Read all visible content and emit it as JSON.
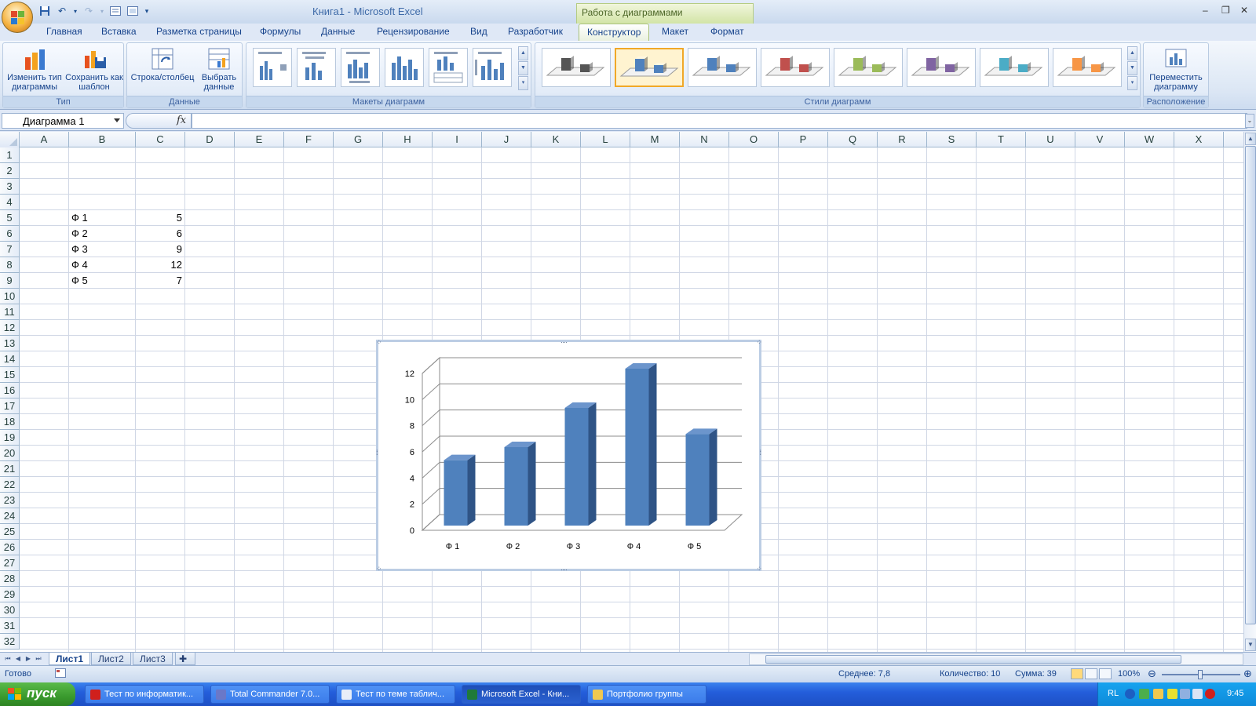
{
  "titlebar": {
    "title": "Книга1 - Microsoft Excel",
    "context_group": "Работа с диаграммами"
  },
  "tabs": [
    "Главная",
    "Вставка",
    "Разметка страницы",
    "Формулы",
    "Данные",
    "Рецензирование",
    "Вид",
    "Разработчик",
    "Конструктор",
    "Макет",
    "Формат"
  ],
  "active_tab": "Конструктор",
  "ribbon": {
    "groups": {
      "type": {
        "label": "Тип",
        "change_type": "Изменить тип диаграммы",
        "save_template": "Сохранить как шаблон"
      },
      "data": {
        "label": "Данные",
        "row_col": "Строка/столбец",
        "select_data": "Выбрать данные"
      },
      "layouts": {
        "label": "Макеты диаграмм"
      },
      "styles": {
        "label": "Стили диаграмм",
        "colors": [
          "#555555",
          "#4f81bd",
          "#4f81bd",
          "#c0504d",
          "#9bbb59",
          "#8064a2",
          "#4bacc6",
          "#f79646"
        ],
        "selected_index": 1
      },
      "location": {
        "label": "Расположение",
        "move_chart": "Переместить диаграмму"
      }
    }
  },
  "formula_bar": {
    "name_box": "Диаграмма 1",
    "fx": "fx",
    "value": ""
  },
  "columns": [
    "A",
    "B",
    "C",
    "D",
    "E",
    "F",
    "G",
    "H",
    "I",
    "J",
    "K",
    "L",
    "M",
    "N",
    "O",
    "P",
    "Q",
    "R",
    "S",
    "T",
    "U",
    "V",
    "W",
    "X"
  ],
  "rows": [
    "1",
    "2",
    "3",
    "4",
    "5",
    "6",
    "7",
    "8",
    "9",
    "10",
    "11",
    "12",
    "13",
    "14",
    "15",
    "16",
    "17",
    "18",
    "19",
    "20",
    "21",
    "22",
    "23",
    "24",
    "25",
    "26",
    "27",
    "28",
    "29",
    "30",
    "31",
    "32"
  ],
  "cells": {
    "B5": "Ф 1",
    "C5": "5",
    "B6": "Ф 2",
    "C6": "6",
    "B7": "Ф 3",
    "C7": "9",
    "B8": "Ф 4",
    "C8": "12",
    "B9": "Ф 5",
    "C9": "7"
  },
  "chart_data": {
    "type": "bar",
    "categories": [
      "Ф 1",
      "Ф 2",
      "Ф 3",
      "Ф 4",
      "Ф 5"
    ],
    "values": [
      5,
      6,
      9,
      12,
      7
    ],
    "ylim": [
      0,
      12
    ],
    "yticks": [
      "0",
      "2",
      "4",
      "6",
      "8",
      "10",
      "12"
    ],
    "grid": true,
    "bar_color": "#4f81bd",
    "bar_side_color": "#2f5486",
    "bar_top_color": "#6c95cc"
  },
  "sheets": [
    "Лист1",
    "Лист2",
    "Лист3"
  ],
  "active_sheet": "Лист1",
  "status": {
    "ready": "Готово",
    "average": "Среднее: 7,8",
    "count": "Количество: 10",
    "sum": "Сумма: 39",
    "zoom": "100%"
  },
  "taskbar": {
    "start": "пуск",
    "tasks": [
      {
        "label": "Тест по информатик...",
        "icon": "opera-icon",
        "color": "#d0201c"
      },
      {
        "label": "Total Commander 7.0...",
        "icon": "floppy-icon",
        "color": "#6a78c8"
      },
      {
        "label": "Тест по теме таблич...",
        "icon": "document-icon",
        "color": "#e8eef8"
      },
      {
        "label": "Microsoft Excel - Кни...",
        "icon": "excel-icon",
        "color": "#1f7a3a"
      },
      {
        "label": "Портфолио группы",
        "icon": "folder-icon",
        "color": "#f0c850"
      }
    ],
    "active_task": 3,
    "lang": "RL",
    "clock": "9:45"
  }
}
